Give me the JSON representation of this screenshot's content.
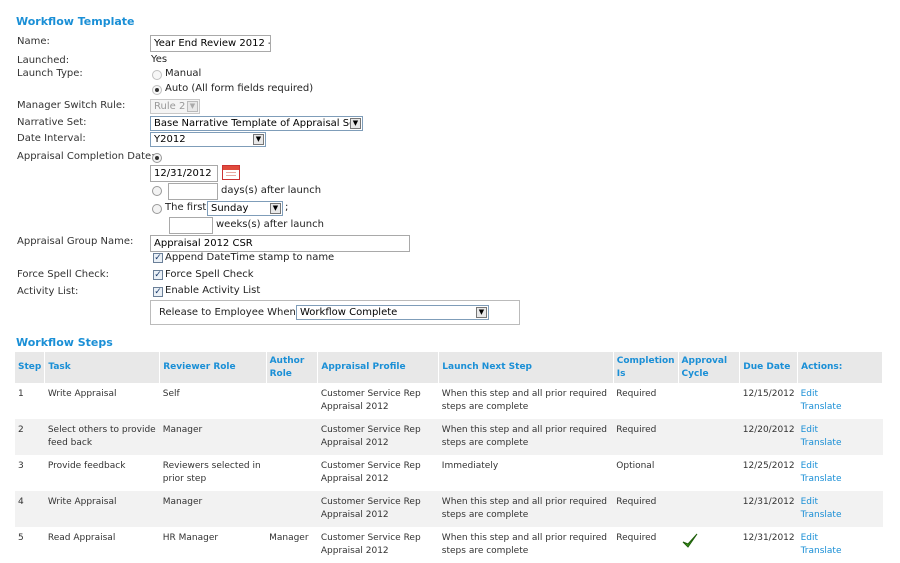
{
  "template": {
    "title": "Workflow Template",
    "name_label": "Name:",
    "name_value": "Year End Review 2012 -",
    "launched_label": "Launched:",
    "launched_value": "Yes",
    "launch_type_label": "Launch Type:",
    "launch_manual": "Manual",
    "launch_auto": "Auto (All form fields required)",
    "manager_switch_label": "Manager Switch Rule:",
    "manager_switch_value": "Rule 2",
    "narrative_label": "Narrative Set:",
    "narrative_value": "Base Narrative Template of Appraisal Set",
    "date_interval_label": "Date Interval:",
    "date_interval_value": "Y2012",
    "completion_label": "Appraisal Completion Date:",
    "completion_date": "12/31/2012",
    "days_after_label": "days(s) after launch",
    "the_first_label": "The first",
    "weekday_value": "Sunday",
    "semicolon": ";",
    "weeks_after_label": "weeks(s) after launch",
    "group_name_label": "Appraisal Group Name:",
    "group_name_value": "Appraisal 2012 CSR",
    "append_stamp_label": "Append DateTime stamp to name",
    "spell_check_label": "Force Spell Check:",
    "spell_check_option": "Force Spell Check",
    "activity_list_label": "Activity List:",
    "activity_list_option": "Enable Activity List",
    "release_label": "Release to Employee When:",
    "release_value": "Workflow Complete"
  },
  "steps": {
    "title": "Workflow Steps",
    "headers": {
      "step": "Step",
      "task": "Task",
      "reviewer_role": "Reviewer Role",
      "author_role_1": "Author",
      "author_role_2": "Role",
      "profile": "Appraisal Profile",
      "launch_next": "Launch Next Step",
      "completion_1": "Completion",
      "completion_2": "Is",
      "approval_1": "Approval",
      "approval_2": "Cycle",
      "due_date": "Due Date",
      "actions": "Actions:"
    },
    "rows": [
      {
        "step": "1",
        "task": "Write Appraisal",
        "reviewer": "Self",
        "author": "",
        "profile": "Customer Service Rep Appraisal 2012",
        "launch": "When this step and all prior required steps are complete",
        "completion": "Required",
        "approval": false,
        "due": "12/15/2012",
        "edit": "Edit",
        "translate": "Translate"
      },
      {
        "step": "2",
        "task": "Select others to provide feed back",
        "reviewer": "Manager",
        "author": "",
        "profile": "Customer Service Rep Appraisal 2012",
        "launch": "When this step and all prior required steps are complete",
        "completion": "Required",
        "approval": false,
        "due": "12/20/2012",
        "edit": "Edit",
        "translate": "Translate"
      },
      {
        "step": "3",
        "task": "Provide feedback",
        "reviewer": "Reviewers selected in prior step",
        "author": "",
        "profile": "Customer Service Rep Appraisal 2012",
        "launch": "Immediately",
        "completion": "Optional",
        "approval": false,
        "due": "12/25/2012",
        "edit": "Edit",
        "translate": "Translate"
      },
      {
        "step": "4",
        "task": "Write Appraisal",
        "reviewer": "Manager",
        "author": "",
        "profile": "Customer Service Rep Appraisal 2012",
        "launch": "When this step and all prior required steps are complete",
        "completion": "Required",
        "approval": false,
        "due": "12/31/2012",
        "edit": "Edit",
        "translate": "Translate"
      },
      {
        "step": "5",
        "task": "Read Appraisal",
        "reviewer": "HR Manager",
        "author": "Manager",
        "profile": "Customer Service Rep Appraisal 2012",
        "launch": "When this step and all prior required steps are complete",
        "completion": "Required",
        "approval": true,
        "due": "12/31/2012",
        "edit": "Edit",
        "translate": "Translate"
      }
    ]
  },
  "colors": {
    "accent": "#1a8fd6",
    "header_bg": "#e8e8e8",
    "row_alt": "#f2f2f2",
    "check_green": "#3a9a1a"
  }
}
